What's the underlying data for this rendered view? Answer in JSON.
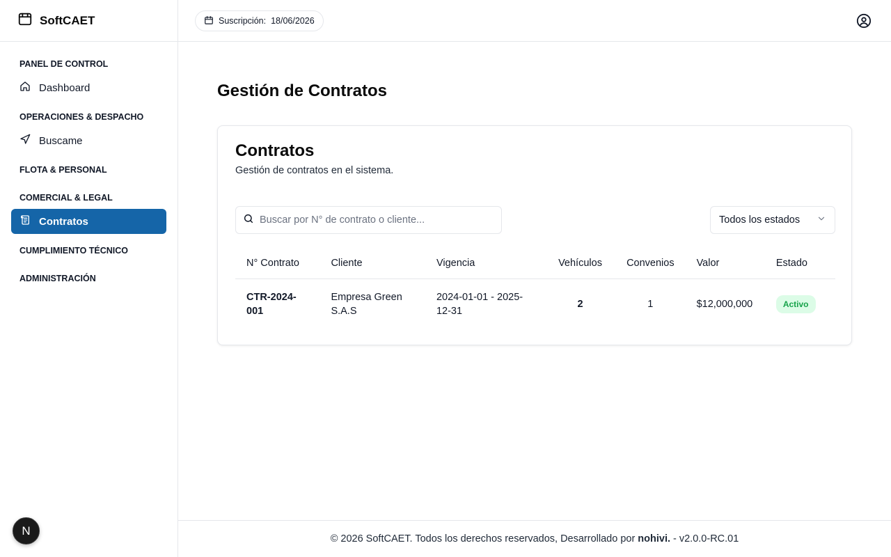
{
  "app": {
    "name": "SoftCAET"
  },
  "sidebar": {
    "groups": [
      {
        "title": "PANEL DE CONTROL",
        "items": [
          {
            "label": "Dashboard",
            "icon": "home-icon"
          }
        ]
      },
      {
        "title": "OPERACIONES & DESPACHO",
        "items": [
          {
            "label": "Buscame",
            "icon": "navigation-icon"
          }
        ]
      },
      {
        "title": "FLOTA & PERSONAL",
        "items": []
      },
      {
        "title": "COMERCIAL & LEGAL",
        "items": [
          {
            "label": "Contratos",
            "icon": "scroll-icon",
            "active": true
          }
        ]
      },
      {
        "title": "CUMPLIMIENTO TÉCNICO",
        "items": []
      },
      {
        "title": "ADMINISTRACIÓN",
        "items": []
      }
    ],
    "badge": "N"
  },
  "header": {
    "subscription_label": "Suscripción:",
    "subscription_date": "18/06/2026"
  },
  "page": {
    "title": "Gestión de Contratos"
  },
  "card": {
    "title": "Contratos",
    "subtitle": "Gestión de contratos en el sistema.",
    "search_placeholder": "Buscar por N° de contrato o cliente...",
    "status_filter": "Todos los estados",
    "columns": [
      "N° Contrato",
      "Cliente",
      "Vigencia",
      "Vehículos",
      "Convenios",
      "Valor",
      "Estado"
    ],
    "rows": [
      {
        "contrato": "CTR-2024-001",
        "cliente": "Empresa Green S.A.S",
        "vigencia": "2024-01-01 - 2025-12-31",
        "vehiculos": "2",
        "convenios": "1",
        "valor": "$12,000,000",
        "estado": "Activo"
      }
    ]
  },
  "footer": {
    "prefix": "© 2026 SoftCAET. Todos los derechos reservados, Desarrollado por",
    "developer": "nohivi.",
    "version": "- v2.0.0-RC.01"
  },
  "colors": {
    "accent": "#1565a8",
    "active_badge_bg": "#dcfce7",
    "active_badge_text": "#16a34a"
  }
}
